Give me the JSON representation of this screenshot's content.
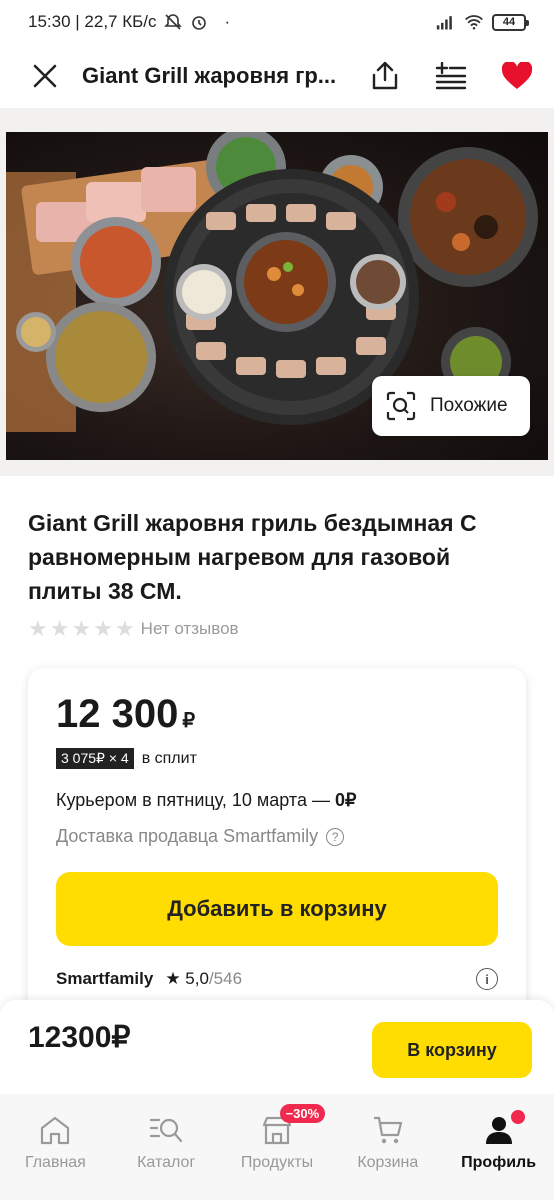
{
  "status_bar": {
    "time_info": "15:30 | 22,7 КБ/с",
    "battery": "44"
  },
  "header": {
    "title": "Giant Grill жаровня гриль бездымная",
    "title_display": "Giant Grill жаровня гр...",
    "icons": [
      "close-icon",
      "share-icon",
      "add-to-list-icon",
      "heart-icon"
    ]
  },
  "gallery": {
    "similar_label": "Похожие"
  },
  "product": {
    "title": "Giant Grill жаровня гриль бездымная С равномерным нагревом для газовой плиты 38 СМ.",
    "rating_stars": 0,
    "reviews_text": "Нет отзывов"
  },
  "offer": {
    "price": "12 300",
    "currency": "₽",
    "split_badge": "3 075₽ × 4",
    "split_text": "в сплит",
    "delivery_text": "Курьером в пятницу, 10 марта — ",
    "delivery_price": "0₽",
    "seller_delivery": "Доставка продавца Smartfamily",
    "add_to_cart": "Добавить в корзину",
    "seller_name": "Smartfamily",
    "seller_rating": "★ 5,0",
    "seller_reviews": "/546"
  },
  "buy_bar": {
    "price": "12300₽",
    "button": "В корзину"
  },
  "bottom_nav": {
    "items": [
      {
        "label": "Главная",
        "icon": "home-icon"
      },
      {
        "label": "Каталог",
        "icon": "catalog-search-icon"
      },
      {
        "label": "Продукты",
        "icon": "grocery-store-icon",
        "badge": "−30%"
      },
      {
        "label": "Корзина",
        "icon": "cart-icon"
      },
      {
        "label": "Профиль",
        "icon": "profile-icon",
        "active": true
      }
    ]
  },
  "colors": {
    "accent_yellow": "#ffdd00",
    "heart_red": "#e8112d",
    "badge_red": "#f2294e"
  }
}
